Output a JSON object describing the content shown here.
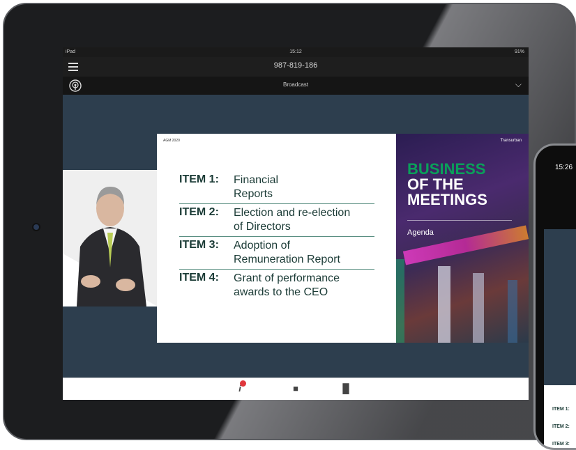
{
  "ipad": {
    "status": {
      "carrier": "iPad ",
      "time": "15:12",
      "battery": "91%"
    },
    "meeting_id": "987-819-186",
    "subheader": {
      "label": "Broadcast"
    },
    "bottom_icons": [
      "info-icon",
      "chat-icon",
      "poll-icon"
    ]
  },
  "slide": {
    "header_left": "AGM 2020",
    "brand": "Transurban",
    "title_line1": "BUSINESS",
    "title_line2": "OF THE",
    "title_line3": "MEETINGS",
    "subtitle": "Agenda",
    "items": [
      {
        "key": "ITEM 1:",
        "text_line1": "Financial",
        "text_line2": "Reports"
      },
      {
        "key": "ITEM 2:",
        "text_line1": "Election and re-election",
        "text_line2": "of Directors"
      },
      {
        "key": "ITEM 3:",
        "text_line1": "Adoption of",
        "text_line2": "Remuneration Report"
      },
      {
        "key": "ITEM 4:",
        "text_line1": "Grant of performance",
        "text_line2": "awards to the CEO"
      }
    ]
  },
  "phone": {
    "time": "15:26",
    "items": [
      "ITEM 1:",
      "ITEM 2:",
      "ITEM 3:"
    ]
  },
  "colors": {
    "accent_green": "#0aa05a",
    "dark_teal": "#1b3b36",
    "badge_red": "#e0373c",
    "screen_bg": "#2d3e4e"
  }
}
